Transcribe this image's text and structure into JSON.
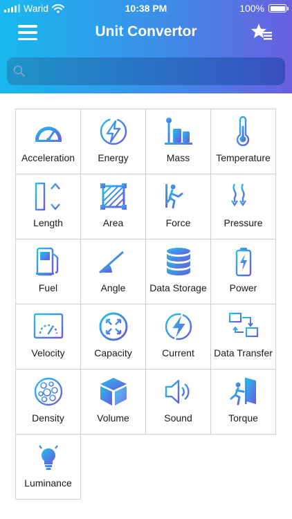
{
  "status_bar": {
    "carrier": "Warid",
    "time": "10:38 PM",
    "battery": "100%"
  },
  "header": {
    "title": "Unit Convertor"
  },
  "search": {
    "placeholder": ""
  },
  "colors": {
    "gradient_start": "#17b9ef",
    "gradient_end": "#6a5fe0",
    "icon_start": "#22c0ee",
    "icon_end": "#6a57e0"
  },
  "units": [
    {
      "label": "Acceleration",
      "icon": "speedometer-icon"
    },
    {
      "label": "Energy",
      "icon": "energy-bolt-icon"
    },
    {
      "label": "Mass",
      "icon": "mass-weights-icon"
    },
    {
      "label": "Temperature",
      "icon": "thermometer-icon"
    },
    {
      "label": "Length",
      "icon": "ruler-icon"
    },
    {
      "label": "Area",
      "icon": "area-square-icon"
    },
    {
      "label": "Force",
      "icon": "force-runner-icon"
    },
    {
      "label": "Pressure",
      "icon": "pressure-arrows-icon"
    },
    {
      "label": "Fuel",
      "icon": "fuel-pump-icon"
    },
    {
      "label": "Angle",
      "icon": "angle-icon"
    },
    {
      "label": "Data Storage",
      "icon": "database-icon"
    },
    {
      "label": "Power",
      "icon": "battery-icon"
    },
    {
      "label": "Velocity",
      "icon": "velocity-gauge-icon"
    },
    {
      "label": "Capacity",
      "icon": "capacity-expand-icon"
    },
    {
      "label": "Current",
      "icon": "current-bolt-icon"
    },
    {
      "label": "Data Transfer",
      "icon": "data-transfer-icon"
    },
    {
      "label": "Density",
      "icon": "density-circles-icon"
    },
    {
      "label": "Volume",
      "icon": "cube-icon"
    },
    {
      "label": "Sound",
      "icon": "speaker-icon"
    },
    {
      "label": "Torque",
      "icon": "torque-door-icon"
    },
    {
      "label": "Luminance",
      "icon": "light-bulb-icon"
    }
  ]
}
